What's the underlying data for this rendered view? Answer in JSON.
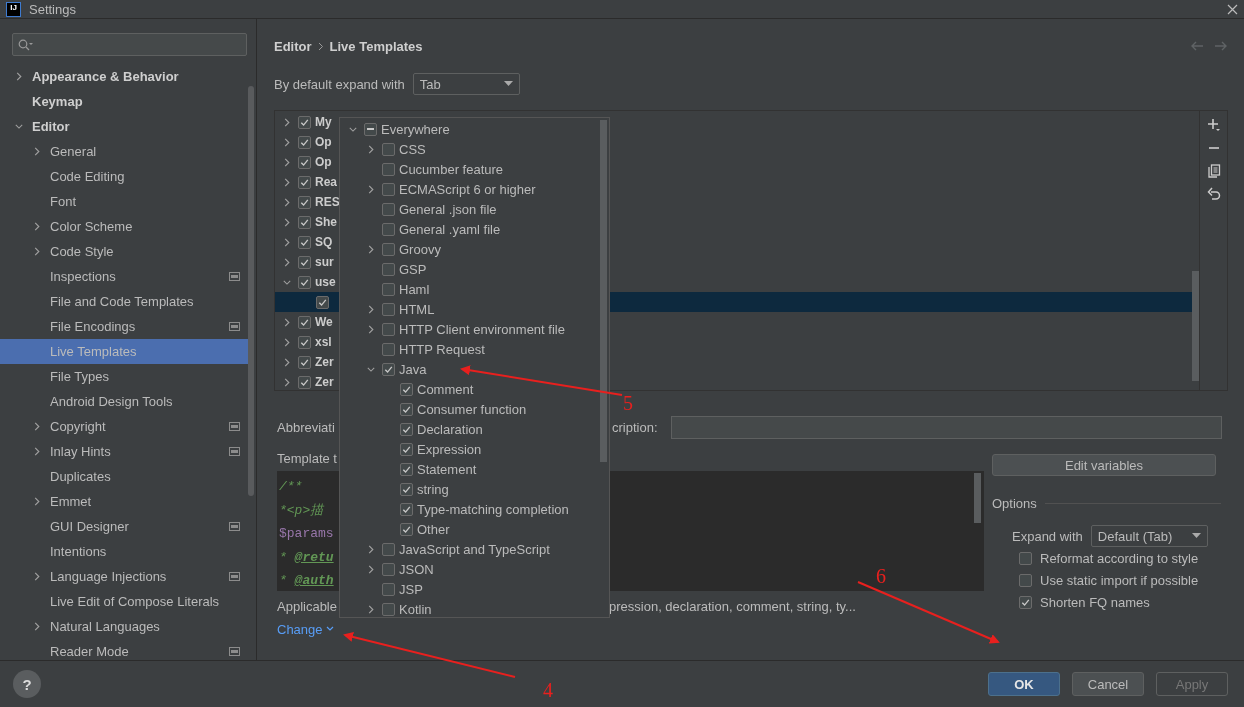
{
  "window": {
    "icon_text": "IJ",
    "title": "Settings"
  },
  "sidebar": {
    "items": [
      {
        "label": "Appearance & Behavior",
        "expandable": true,
        "expanded": false,
        "selected": false,
        "scope_icon": false
      },
      {
        "label": "Keymap",
        "expandable": false,
        "expanded": false,
        "selected": false,
        "scope_icon": false
      },
      {
        "label": "Editor",
        "expandable": true,
        "expanded": true,
        "selected": false,
        "scope_icon": false,
        "children": [
          {
            "label": "General",
            "expandable": true,
            "expanded": false,
            "selected": false,
            "scope_icon": false
          },
          {
            "label": "Code Editing",
            "expandable": false,
            "expanded": false,
            "selected": false,
            "scope_icon": false
          },
          {
            "label": "Font",
            "expandable": false,
            "expanded": false,
            "selected": false,
            "scope_icon": false
          },
          {
            "label": "Color Scheme",
            "expandable": true,
            "expanded": false,
            "selected": false,
            "scope_icon": false
          },
          {
            "label": "Code Style",
            "expandable": true,
            "expanded": false,
            "selected": false,
            "scope_icon": false
          },
          {
            "label": "Inspections",
            "expandable": false,
            "expanded": false,
            "selected": false,
            "scope_icon": true
          },
          {
            "label": "File and Code Templates",
            "expandable": false,
            "expanded": false,
            "selected": false,
            "scope_icon": false
          },
          {
            "label": "File Encodings",
            "expandable": false,
            "expanded": false,
            "selected": false,
            "scope_icon": true
          },
          {
            "label": "Live Templates",
            "expandable": false,
            "expanded": false,
            "selected": true,
            "scope_icon": false
          },
          {
            "label": "File Types",
            "expandable": false,
            "expanded": false,
            "selected": false,
            "scope_icon": false
          },
          {
            "label": "Android Design Tools",
            "expandable": false,
            "expanded": false,
            "selected": false,
            "scope_icon": false
          },
          {
            "label": "Copyright",
            "expandable": true,
            "expanded": false,
            "selected": false,
            "scope_icon": true
          },
          {
            "label": "Inlay Hints",
            "expandable": true,
            "expanded": false,
            "selected": false,
            "scope_icon": true
          },
          {
            "label": "Duplicates",
            "expandable": false,
            "expanded": false,
            "selected": false,
            "scope_icon": false
          },
          {
            "label": "Emmet",
            "expandable": true,
            "expanded": false,
            "selected": false,
            "scope_icon": false
          },
          {
            "label": "GUI Designer",
            "expandable": false,
            "expanded": false,
            "selected": false,
            "scope_icon": true
          },
          {
            "label": "Intentions",
            "expandable": false,
            "expanded": false,
            "selected": false,
            "scope_icon": false
          },
          {
            "label": "Language Injections",
            "expandable": true,
            "expanded": false,
            "selected": false,
            "scope_icon": true
          },
          {
            "label": "Live Edit of Compose Literals",
            "expandable": false,
            "expanded": false,
            "selected": false,
            "scope_icon": false
          },
          {
            "label": "Natural Languages",
            "expandable": true,
            "expanded": false,
            "selected": false,
            "scope_icon": false
          },
          {
            "label": "Reader Mode",
            "expandable": false,
            "expanded": false,
            "selected": false,
            "scope_icon": true
          }
        ]
      }
    ]
  },
  "breadcrumb": [
    "Editor",
    "Live Templates"
  ],
  "expand_with": {
    "label": "By default expand with",
    "value": "Tab"
  },
  "templates": [
    {
      "name": "My",
      "checked": true,
      "expanded": false,
      "selected": false
    },
    {
      "name": "Op",
      "checked": true,
      "expanded": false,
      "selected": false
    },
    {
      "name": "Op",
      "checked": true,
      "expanded": false,
      "selected": false
    },
    {
      "name": "Rea",
      "checked": true,
      "expanded": false,
      "selected": false
    },
    {
      "name": "RES",
      "checked": true,
      "expanded": false,
      "selected": false
    },
    {
      "name": "She",
      "checked": true,
      "expanded": false,
      "selected": false
    },
    {
      "name": "SQ",
      "checked": true,
      "expanded": false,
      "selected": false
    },
    {
      "name": "sur",
      "checked": true,
      "expanded": false,
      "selected": false
    },
    {
      "name": "use",
      "checked": true,
      "expanded": true,
      "selected": false,
      "children": [
        {
          "checked": true,
          "selected": true
        }
      ]
    },
    {
      "name": "We",
      "checked": true,
      "expanded": false,
      "selected": false
    },
    {
      "name": "xsl",
      "checked": true,
      "expanded": false,
      "selected": false
    },
    {
      "name": "Zer",
      "checked": true,
      "expanded": false,
      "selected": false
    },
    {
      "name": "Zer",
      "checked": true,
      "expanded": false,
      "selected": false
    }
  ],
  "abbreviation": {
    "label": "Abbreviati",
    "description_label": "cription:"
  },
  "template_text": {
    "label": "Template t",
    "lines": [
      [
        {
          "text": "/**",
          "kind": "comment"
        }
      ],
      [
        {
          "text": "*<p>描",
          "kind": "comment"
        }
      ],
      [
        {
          "text": "$params",
          "kind": "variable"
        }
      ],
      [
        {
          "text": "* ",
          "kind": "comment"
        },
        {
          "text": "@retu",
          "kind": "doc_tag"
        }
      ],
      [
        {
          "text": "* ",
          "kind": "comment"
        },
        {
          "text": "@auth",
          "kind": "doc_tag"
        }
      ]
    ]
  },
  "applicable": {
    "label": "Applicable",
    "contexts": "pression, declaration, comment, string, ty...",
    "change_link": "Change"
  },
  "edit_variables": "Edit variables",
  "options": {
    "title": "Options",
    "expand_label": "Expand with",
    "expand_value": "Default (Tab)",
    "checkboxes": [
      {
        "label": "Reformat according to style",
        "checked": false
      },
      {
        "label": "Use static import if possible",
        "checked": false
      },
      {
        "label": "Shorten FQ names",
        "checked": true
      }
    ]
  },
  "popup": {
    "root": {
      "label": "Everywhere",
      "expanded": true,
      "partial": true
    },
    "items": [
      {
        "label": "CSS",
        "expandable": true,
        "expanded": false,
        "checked": false
      },
      {
        "label": "Cucumber feature",
        "expandable": false,
        "expanded": false,
        "checked": false
      },
      {
        "label": "ECMAScript 6 or higher",
        "expandable": true,
        "expanded": false,
        "checked": false
      },
      {
        "label": "General .json file",
        "expandable": false,
        "expanded": false,
        "checked": false
      },
      {
        "label": "General .yaml file",
        "expandable": false,
        "expanded": false,
        "checked": false
      },
      {
        "label": "Groovy",
        "expandable": true,
        "expanded": false,
        "checked": false
      },
      {
        "label": "GSP",
        "expandable": false,
        "expanded": false,
        "checked": false
      },
      {
        "label": "Haml",
        "expandable": false,
        "expanded": false,
        "checked": false
      },
      {
        "label": "HTML",
        "expandable": true,
        "expanded": false,
        "checked": false
      },
      {
        "label": "HTTP Client environment file",
        "expandable": true,
        "expanded": false,
        "checked": false
      },
      {
        "label": "HTTP Request",
        "expandable": false,
        "expanded": false,
        "checked": false
      },
      {
        "label": "Java",
        "expandable": true,
        "expanded": true,
        "checked": true,
        "children": [
          {
            "label": "Comment",
            "checked": true
          },
          {
            "label": "Consumer function",
            "checked": true
          },
          {
            "label": "Declaration",
            "checked": true
          },
          {
            "label": "Expression",
            "checked": true
          },
          {
            "label": "Statement",
            "checked": true
          },
          {
            "label": "string",
            "checked": true
          },
          {
            "label": "Type-matching completion",
            "checked": true
          },
          {
            "label": "Other",
            "checked": true
          }
        ]
      },
      {
        "label": "JavaScript and TypeScript",
        "expandable": true,
        "expanded": false,
        "checked": false
      },
      {
        "label": "JSON",
        "expandable": true,
        "expanded": false,
        "checked": false
      },
      {
        "label": "JSP",
        "expandable": false,
        "expanded": false,
        "checked": false
      },
      {
        "label": "Kotlin",
        "expandable": true,
        "expanded": false,
        "checked": false
      }
    ]
  },
  "help": "?",
  "buttons": [
    {
      "label": "OK",
      "kind": "primary"
    },
    {
      "label": "Cancel",
      "kind": "normal"
    },
    {
      "label": "Apply",
      "kind": "disabled"
    }
  ],
  "annotations": [
    {
      "label": "5"
    },
    {
      "label": "6"
    },
    {
      "label": "4"
    }
  ]
}
